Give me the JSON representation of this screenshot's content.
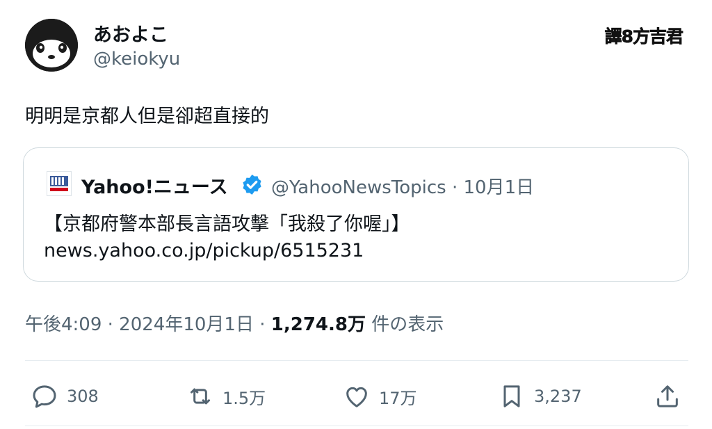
{
  "author": {
    "display_name": "あおよこ",
    "handle": "@keiokyu"
  },
  "watermark": "譯8方吉君",
  "tweet": {
    "text": "明明是京都人但是卻超直接的",
    "time": "午後4:09 · 2024年10月1日 · ",
    "views_count": "1,274.8万",
    "views_label": " 件の表示"
  },
  "quote": {
    "name": "Yahoo!ニュース",
    "handle_date": "@YahooNewsTopics · 10月1日",
    "text": "【京都府警本部長言語攻擊「我殺了你喔」】",
    "link": "news.yahoo.co.jp/pickup/6515231"
  },
  "actions": {
    "replies": "308",
    "reposts": "1.5万",
    "likes": "17万",
    "bookmarks": "3,237"
  },
  "icons": [
    "avatar-icon",
    "verified-badge-icon",
    "reply-icon",
    "repost-icon",
    "like-icon",
    "bookmark-icon",
    "share-icon"
  ],
  "colors": {
    "text": "#0f1419",
    "secondary": "#536471",
    "verified": "#1d9bf0",
    "border": "#cfd9de"
  }
}
